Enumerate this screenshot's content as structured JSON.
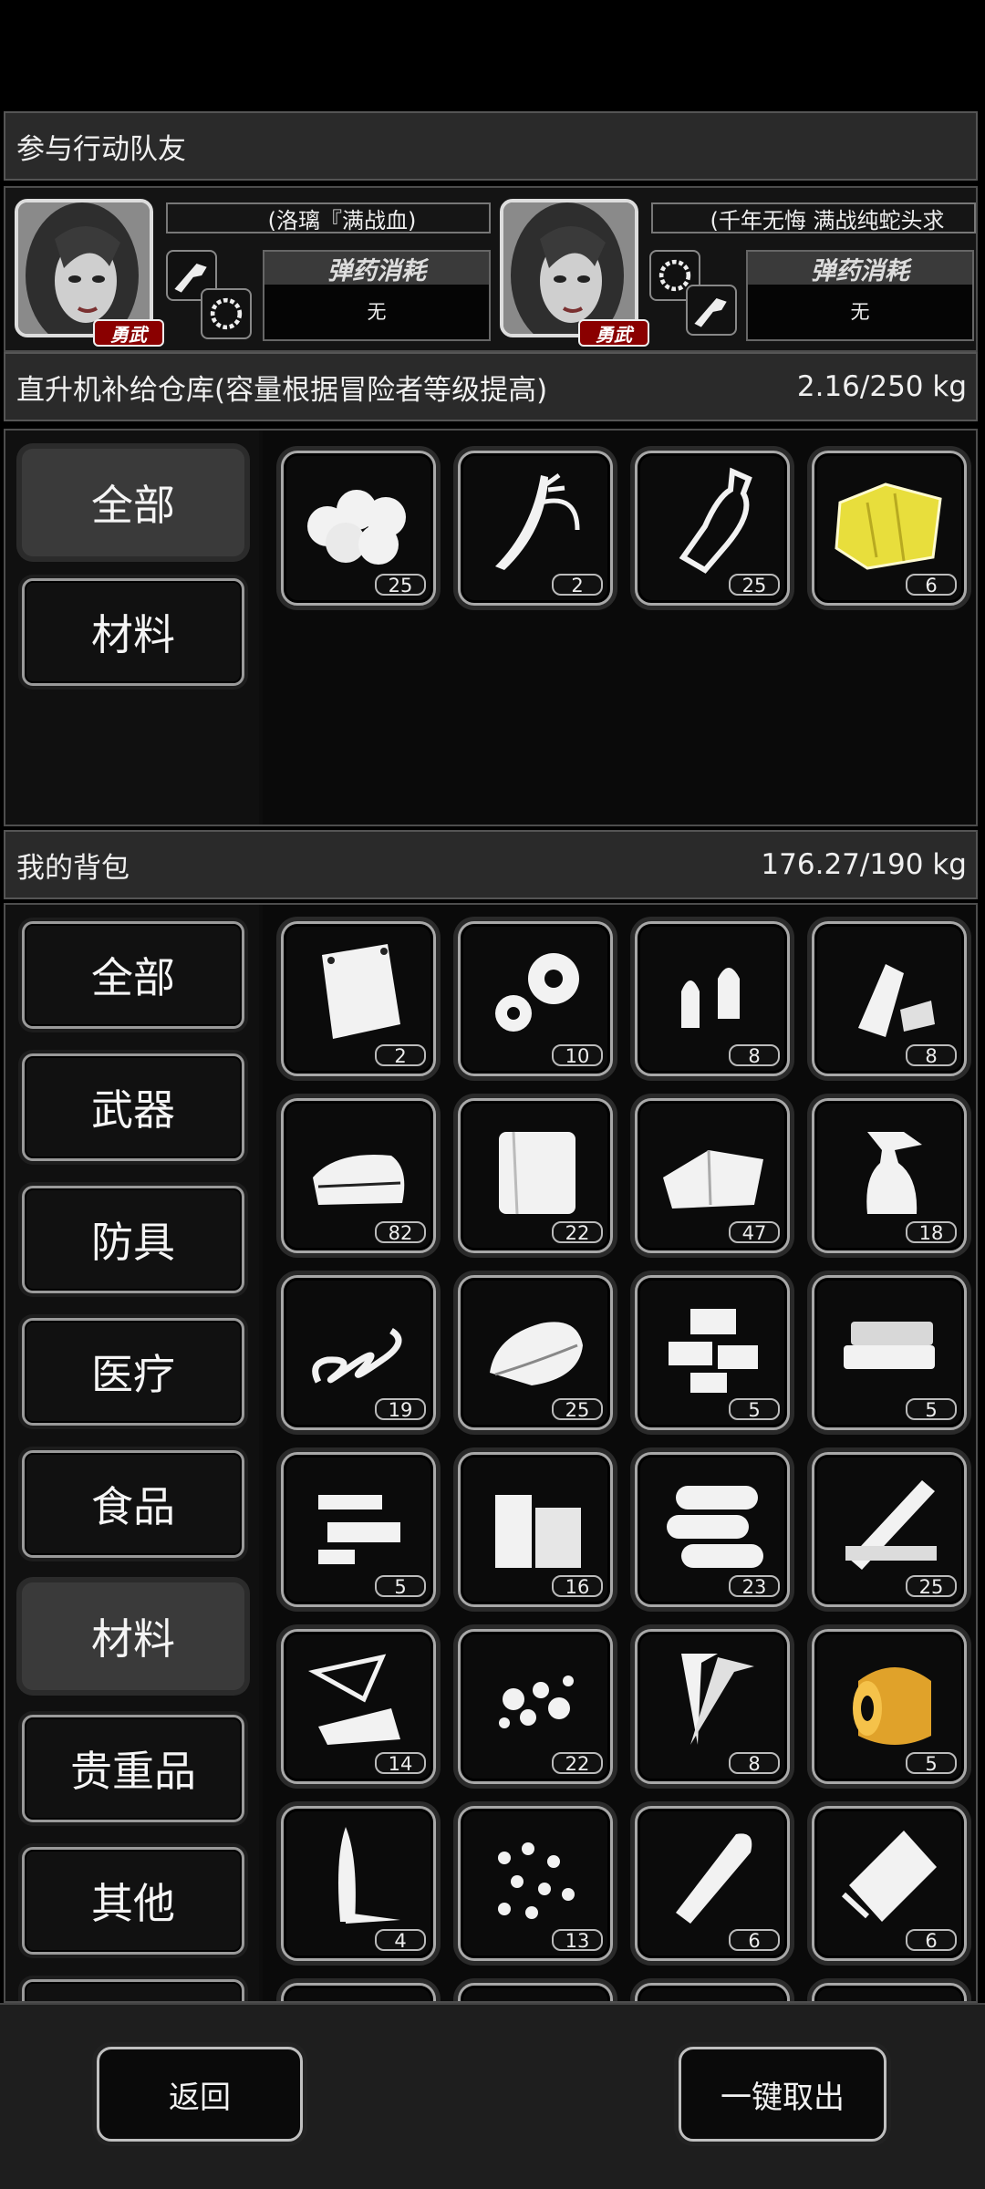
{
  "team": {
    "title": "参与行动队友",
    "members": [
      {
        "name": "(洛璃『满战血)",
        "badge": "勇武",
        "ammo_label": "弹药消耗",
        "ammo_value": "无"
      },
      {
        "name": "(千年无悔 满战纯蛇头求",
        "badge": "勇武",
        "ammo_label": "弹药消耗",
        "ammo_value": "无"
      }
    ]
  },
  "warehouse": {
    "title": "直升机补给仓库(容量根据冒险者等级提高)",
    "capacity": "2.16/250 kg",
    "tabs": [
      {
        "label": "全部",
        "active": true
      },
      {
        "label": "材料",
        "active": false
      }
    ],
    "items": [
      {
        "icon": "cotton-balls-icon",
        "qty": "25"
      },
      {
        "icon": "wires-icon",
        "qty": "2"
      },
      {
        "icon": "plastic-bottle-icon",
        "qty": "25"
      },
      {
        "icon": "yellow-cloth-icon",
        "qty": "6",
        "color": "#e8de3c"
      }
    ]
  },
  "backpack": {
    "title": "我的背包",
    "capacity": "176.27/190 kg",
    "tabs": [
      {
        "label": "全部",
        "active": false
      },
      {
        "label": "武器",
        "active": false
      },
      {
        "label": "防具",
        "active": false
      },
      {
        "label": "医疗",
        "active": false
      },
      {
        "label": "食品",
        "active": false
      },
      {
        "label": "材料",
        "active": true
      },
      {
        "label": "贵重品",
        "active": false
      },
      {
        "label": "其他",
        "active": false
      }
    ],
    "items": [
      {
        "icon": "bag-icon",
        "qty": "2"
      },
      {
        "icon": "gears-icon",
        "qty": "10"
      },
      {
        "icon": "bullets-icon",
        "qty": "8"
      },
      {
        "icon": "crushed-bottles-icon",
        "qty": "8"
      },
      {
        "icon": "folded-cloth-icon",
        "qty": "82"
      },
      {
        "icon": "fabric-icon",
        "qty": "22"
      },
      {
        "icon": "rags-icon",
        "qty": "47"
      },
      {
        "icon": "spray-bottle-icon",
        "qty": "18"
      },
      {
        "icon": "spring-icon",
        "qty": "19"
      },
      {
        "icon": "towel-icon",
        "qty": "25"
      },
      {
        "icon": "bricks-icon",
        "qty": "5"
      },
      {
        "icon": "sponge-icon",
        "qty": "5"
      },
      {
        "icon": "electronic-parts-icon",
        "qty": "5"
      },
      {
        "icon": "wood-blocks-icon",
        "qty": "16"
      },
      {
        "icon": "logs-icon",
        "qty": "23"
      },
      {
        "icon": "planks-icon",
        "qty": "25"
      },
      {
        "icon": "glass-shards-icon",
        "qty": "14"
      },
      {
        "icon": "rubble-icon",
        "qty": "22"
      },
      {
        "icon": "screws-icon",
        "qty": "8"
      },
      {
        "icon": "tape-roll-icon",
        "qty": "5",
        "color": "#e0a22a"
      },
      {
        "icon": "knife-blade-icon",
        "qty": "4"
      },
      {
        "icon": "pellets-icon",
        "qty": "13"
      },
      {
        "icon": "cartridge-icon",
        "qty": "6"
      },
      {
        "icon": "paper-bag-icon",
        "qty": "6"
      }
    ]
  },
  "footer": {
    "back_label": "返回",
    "take_all_label": "一键取出"
  }
}
